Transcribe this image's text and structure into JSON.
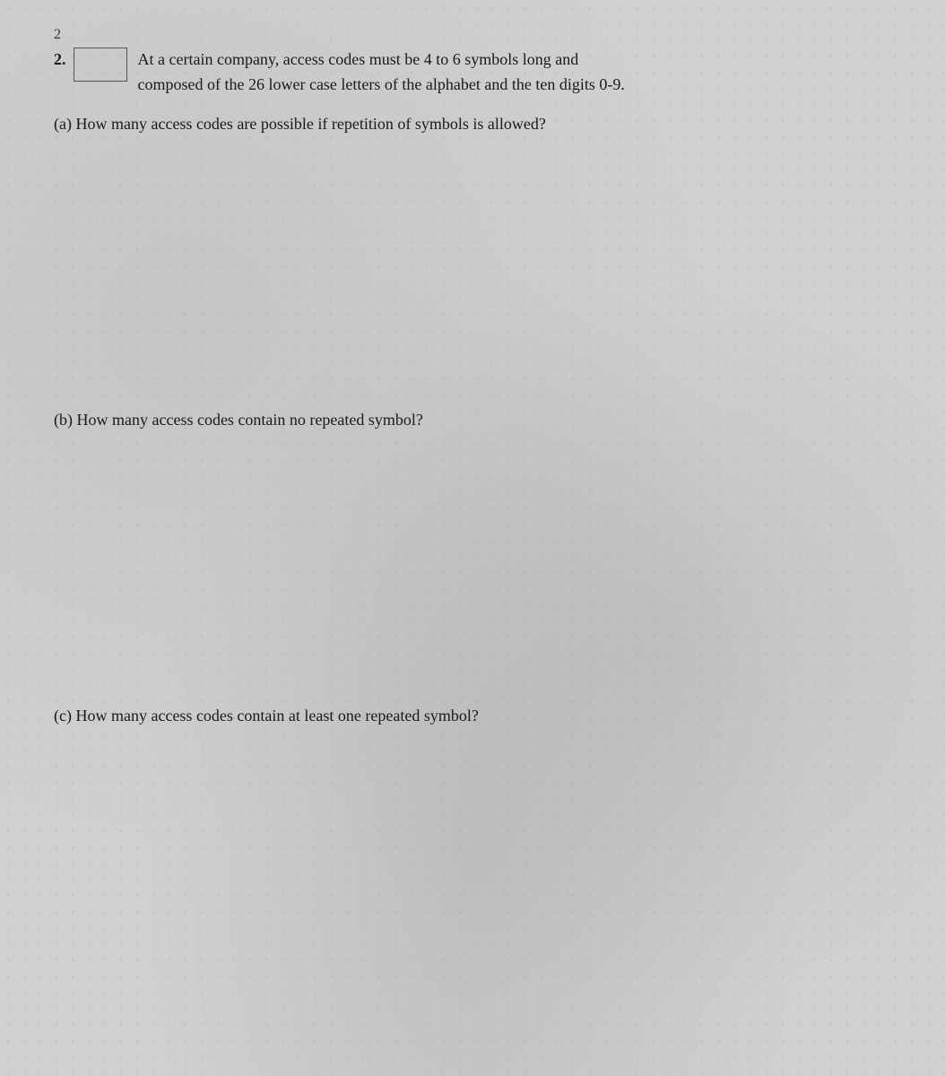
{
  "page": {
    "top_number": "2",
    "question_number": "2.",
    "intro_text_line1": "At a certain company, access codes must be 4 to 6 symbols long and",
    "intro_text_line2": "composed of the 26 lower case letters of the alphabet and the ten digits 0-9.",
    "sub_a_label": "(a)",
    "sub_a_text": "How many access codes are possible if repetition of symbols is allowed?",
    "sub_b_label": "(b)",
    "sub_b_text": "How many access codes contain no repeated symbol?",
    "sub_c_label": "(c)",
    "sub_c_text": "How many access codes contain at least one repeated symbol?"
  }
}
